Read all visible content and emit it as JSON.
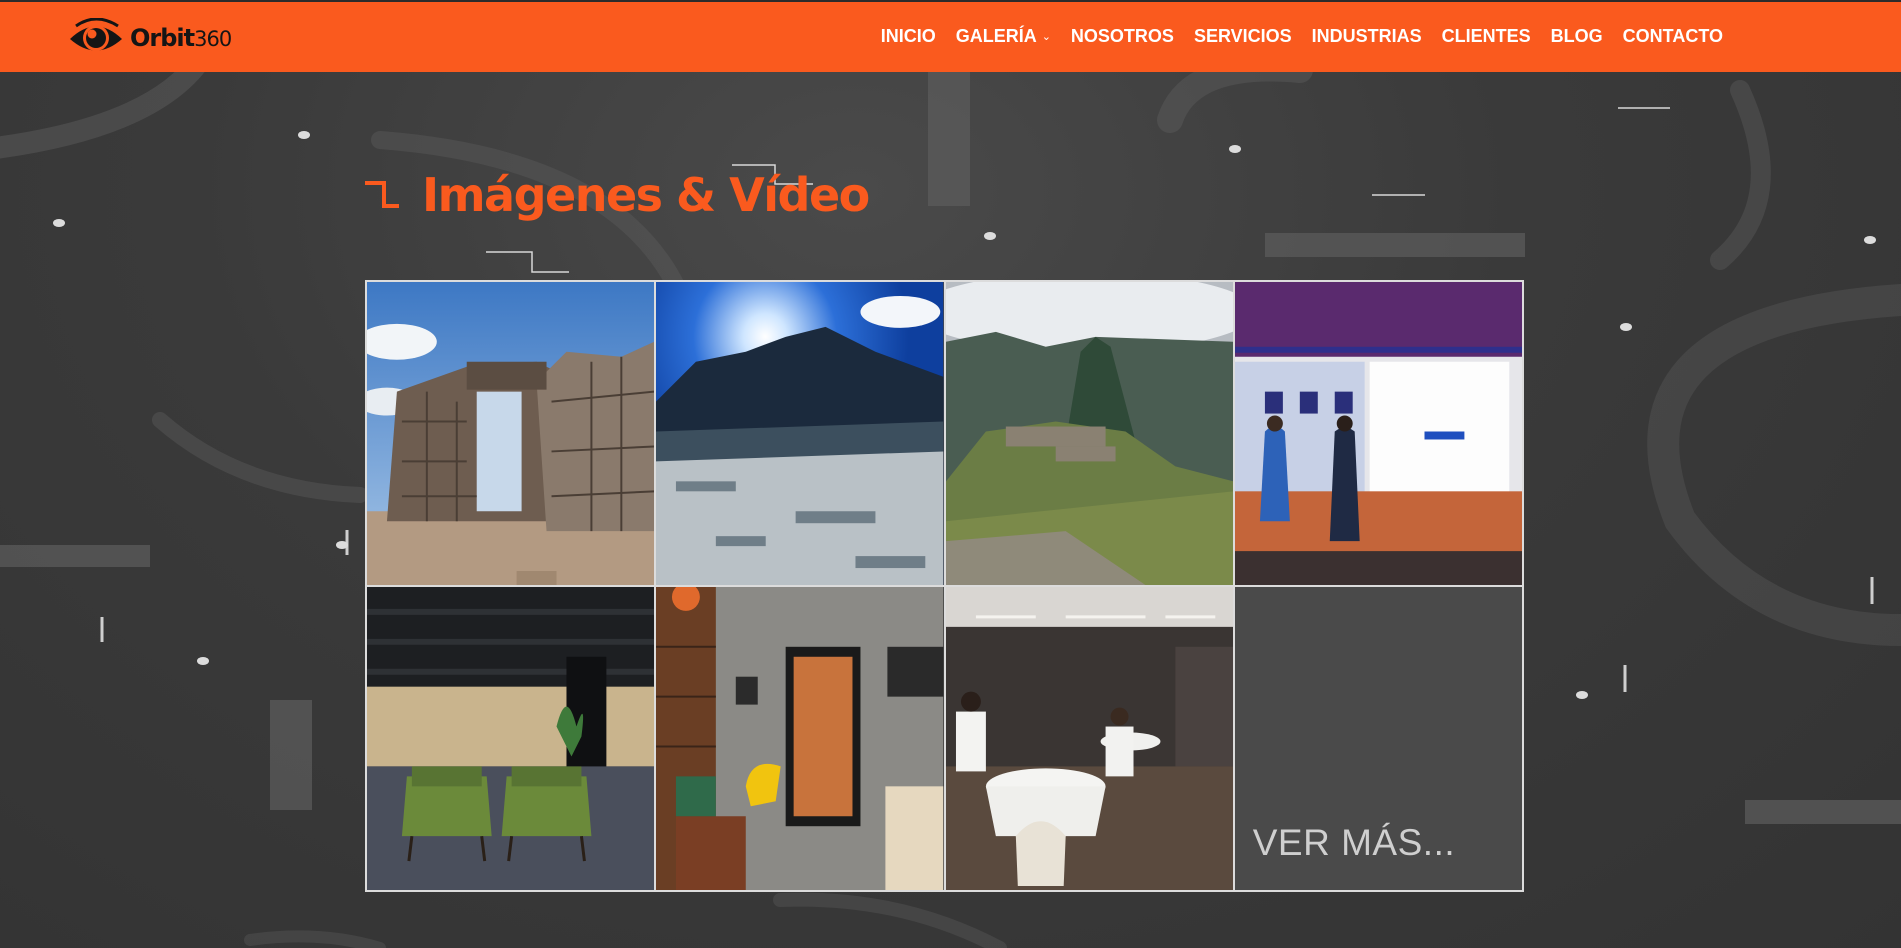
{
  "brand": {
    "name_prefix": "Orbit",
    "name_suffix": "360"
  },
  "nav": {
    "items": [
      {
        "label": "INICIO"
      },
      {
        "label": "GALERÍA",
        "has_dropdown": true
      },
      {
        "label": "NOSOTROS"
      },
      {
        "label": "SERVICIOS"
      },
      {
        "label": "INDUSTRIAS"
      },
      {
        "label": "CLIENTES"
      },
      {
        "label": "BLOG"
      },
      {
        "label": "CONTACTO"
      }
    ]
  },
  "section": {
    "title": "Imágenes & Vídeo"
  },
  "gallery": {
    "tiles": [
      {
        "subject": "inca-stone-doorway"
      },
      {
        "subject": "andean-mountain-sun"
      },
      {
        "subject": "machu-picchu"
      },
      {
        "subject": "trade-fair-booth"
      },
      {
        "subject": "hotel-lobby-green-armchairs"
      },
      {
        "subject": "barbershop-interior"
      },
      {
        "subject": "restaurant-dining-room"
      }
    ],
    "more_label": "VER MÁS..."
  },
  "colors": {
    "accent": "#fa5a1e",
    "background": "#3b3b3b",
    "nav_text": "#ffffff",
    "more_text": "#cfcfcf"
  }
}
